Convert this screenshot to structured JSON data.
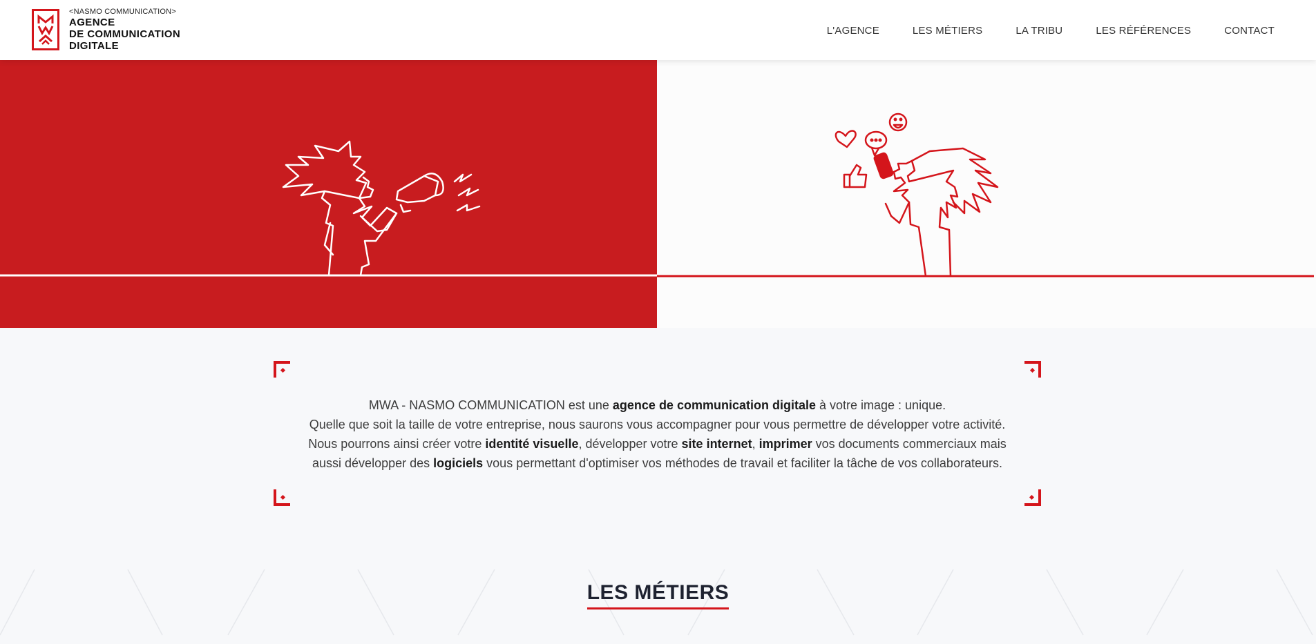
{
  "header": {
    "logo": {
      "mark": "MWA",
      "small": "<NASMO COMMUNICATION>",
      "line1": "AGENCE",
      "line2": "DE COMMUNICATION",
      "line3": "DIGITALE"
    },
    "nav": [
      "L'AGENCE",
      "LES MÉTIERS",
      "LA TRIBU",
      "LES RÉFÉRENCES",
      "CONTACT"
    ]
  },
  "colors": {
    "brand_red": "#c81c1f",
    "accent_red": "#d4151b",
    "text_dark": "#1e2230",
    "background": "#f7f8fa"
  },
  "hero": {
    "left_illustration": "megaphone-person-icon",
    "right_illustration": "phone-person-social-icon"
  },
  "intro": {
    "l1_a": "MWA - NASMO COMMUNICATION est une ",
    "l1_b": "agence de communication digitale",
    "l1_c": " à votre image : unique.",
    "l2": "Quelle que soit la taille de votre entreprise, nous saurons vous accompagner pour vous permettre de développer votre activité.",
    "l3_a": "Nous pourrons ainsi créer votre ",
    "l3_b": "identité visuelle",
    "l3_c": ", développer votre ",
    "l3_d": "site internet",
    "l3_e": ", ",
    "l3_f": "imprimer",
    "l3_g": " vos documents commerciaux mais",
    "l4_a": "aussi développer des ",
    "l4_b": "logiciels",
    "l4_c": " vous permettant d'optimiser vos méthodes de travail et faciliter la tâche de vos collaborateurs."
  },
  "metiers": {
    "title": "LES MÉTIERS"
  }
}
